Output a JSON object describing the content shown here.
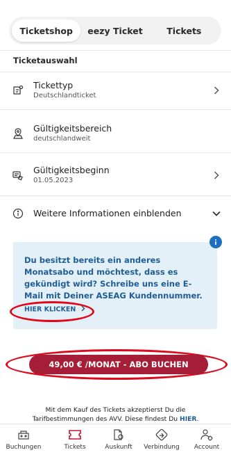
{
  "tabs": [
    {
      "label": "Ticketshop",
      "active": true
    },
    {
      "label": "eezy Ticket",
      "active": false
    },
    {
      "label": "Tickets",
      "active": false
    }
  ],
  "section_title": "Ticketauswahl",
  "rows": [
    {
      "label": "Tickettyp",
      "value": "Deutschlandticket",
      "icon": "ticket-type-icon",
      "chevron": true
    },
    {
      "label": "Gültigkeitsbereich",
      "value": "deutschlandweit",
      "icon": "area-icon",
      "chevron": false
    },
    {
      "label": "Gültigkeitsbeginn",
      "value": "01.05.2023",
      "icon": "calendar-ticket-icon",
      "chevron": true
    }
  ],
  "more_info": {
    "label": "Weitere Informationen einblenden"
  },
  "info_box": {
    "text": "Du besitzt bereits ein anderes Monatsabo und möchtest, dass es gekündigt wird? Schreibe uns eine E-Mail mit Deiner ASEAG Kundennummer.",
    "link_label": "HIER KLICKEN",
    "badge": "i"
  },
  "book_button": {
    "label": "49,00 € /MONAT - ABO BUCHEN"
  },
  "terms": {
    "text": "Mit dem Kauf des Tickets akzeptierst Du die Tarifbestimmungen des AVV. Diese findest Du",
    "link": "HIER",
    "end": "."
  },
  "bottom_nav": [
    {
      "label": "Buchungen",
      "icon": "bookings-icon",
      "active": false
    },
    {
      "label": "Tickets",
      "icon": "tickets-icon",
      "active": true
    },
    {
      "label": "Auskunft",
      "icon": "info-map-icon",
      "active": false
    },
    {
      "label": "Verbindung",
      "icon": "route-icon",
      "active": false
    },
    {
      "label": "Account",
      "icon": "account-icon",
      "active": false
    }
  ],
  "colors": {
    "accent": "#a51d37",
    "active_tab_icon": "#c8102e",
    "info_bg": "#e4f0f8",
    "info_text": "#1f5d95",
    "annotation": "#e0091b"
  }
}
